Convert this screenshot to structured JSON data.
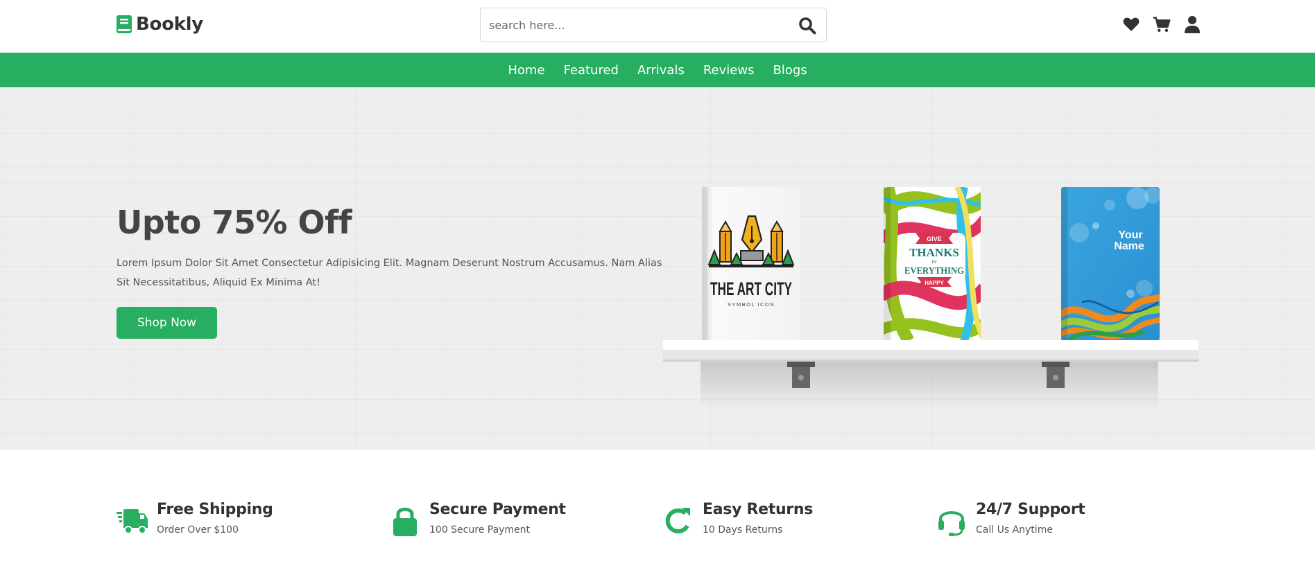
{
  "header": {
    "logo_text": "Bookly",
    "search_placeholder": "search here...",
    "icons": [
      "heart-icon",
      "cart-icon",
      "user-icon"
    ]
  },
  "nav": {
    "items": [
      "Home",
      "Featured",
      "Arrivals",
      "Reviews",
      "Blogs"
    ]
  },
  "hero": {
    "title": "Upto 75% Off",
    "text": "Lorem Ipsum Dolor Sit Amet Consectetur Adipisicing Elit. Magnam Deserunt Nostrum Accusamus. Nam Alias Sit Necessitatibus, Aliquid Ex Minima At!",
    "button_label": "Shop Now",
    "books": {
      "book1": {
        "title": "THE ART CITY",
        "subtitle": "SYMBOL ICON"
      },
      "book2": {
        "line1": "GIVE",
        "line2": "THANKS",
        "line3": "IN",
        "line4": "EVERYTHING",
        "line5": "HAPPY"
      },
      "book3": {
        "line1": "Your",
        "line2": "Name"
      }
    }
  },
  "features": [
    {
      "icon": "truck-icon",
      "title": "Free Shipping",
      "subtitle": "Order Over $100"
    },
    {
      "icon": "lock-icon",
      "title": "Secure Payment",
      "subtitle": "100 Secure Payment"
    },
    {
      "icon": "redo-icon",
      "title": "Easy Returns",
      "subtitle": "10 Days Returns"
    },
    {
      "icon": "headset-icon",
      "title": "24/7 Support",
      "subtitle": "Call Us Anytime"
    }
  ],
  "colors": {
    "brand_green": "#27ae60",
    "text_dark": "#333333",
    "hero_bg": "#eeeeee"
  }
}
